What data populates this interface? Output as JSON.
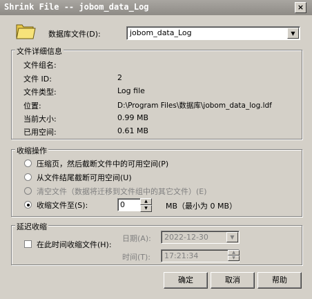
{
  "window": {
    "title": "Shrink File -- jobom_data_Log",
    "close_glyph": "×"
  },
  "database_file": {
    "label": "数据库文件(D):",
    "value": "jobom_data_Log"
  },
  "details": {
    "legend": "文件详细信息",
    "rows": [
      {
        "label": "文件组名:",
        "value": ""
      },
      {
        "label": "文件 ID:",
        "value": "2"
      },
      {
        "label": "文件类型:",
        "value": "Log file"
      },
      {
        "label": "位置:",
        "value": "D:\\Program Files\\数据库\\jobom_data_log.ldf"
      },
      {
        "label": "当前大小:",
        "value": "0.99 MB"
      },
      {
        "label": "已用空间:",
        "value": "0.61 MB"
      }
    ]
  },
  "shrink": {
    "legend": "收缩操作",
    "options": [
      {
        "label": "压缩页，然后截断文件中的可用空间(P)",
        "selected": false,
        "enabled": true
      },
      {
        "label": "从文件结尾截断可用空间(U)",
        "selected": false,
        "enabled": true
      },
      {
        "label": "清空文件（数据将迁移到文件组中的其它文件）(E)",
        "selected": false,
        "enabled": false
      },
      {
        "label": "收缩文件至(S):",
        "selected": true,
        "enabled": true
      }
    ],
    "target_value": "0",
    "unit_note": "MB（最小为 0 MB）"
  },
  "delay": {
    "legend": "延迟收缩",
    "checkbox_label": "在此时间收缩文件(H):",
    "date_label": "日期(A):",
    "date_value": "2022-12-30",
    "time_label": "时间(T):",
    "time_value": "17:21:34"
  },
  "buttons": {
    "ok": "确定",
    "cancel": "取消",
    "help": "帮助"
  }
}
